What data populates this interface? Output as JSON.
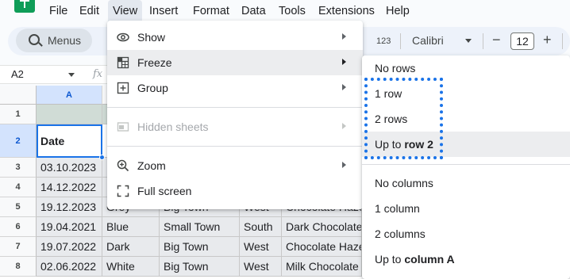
{
  "menubar": {
    "items": [
      "File",
      "Edit",
      "View",
      "Insert",
      "Format",
      "Data",
      "Tools",
      "Extensions",
      "Help"
    ],
    "active": "View"
  },
  "toolbar": {
    "menus_label": "Menus",
    "number_format": "123",
    "font": "Calibri",
    "font_size": "12",
    "minus": "−",
    "plus": "+"
  },
  "formula_bar": {
    "name_box": "A2",
    "fx": "fx"
  },
  "grid": {
    "column_headers": [
      "A"
    ],
    "row_numbers": [
      "1",
      "2",
      "3",
      "4",
      "5",
      "6",
      "7",
      "8"
    ],
    "header_cell": "Date",
    "rows": [
      [
        "03.10.2023"
      ],
      [
        "14.12.2022"
      ],
      [
        "19.12.2023",
        "Grey",
        "Big Town",
        "West",
        "Chocolate Haze"
      ],
      [
        "19.04.2021",
        "Blue",
        "Small Town",
        "South",
        "Dark Chocolate"
      ],
      [
        "19.07.2022",
        "Dark",
        "Big Town",
        "West",
        "Chocolate Haze"
      ],
      [
        "02.06.2022",
        "White",
        "Big Town",
        "West",
        "Milk Chocolate"
      ]
    ],
    "selected_cell": "A2"
  },
  "view_menu": {
    "items": [
      {
        "label": "Show",
        "icon": "eye-icon",
        "submenu": true,
        "disabled": false
      },
      {
        "label": "Freeze",
        "icon": "freeze-grid-icon",
        "submenu": true,
        "disabled": false,
        "highlighted": true
      },
      {
        "label": "Group",
        "icon": "plus-box-icon",
        "submenu": true,
        "disabled": false
      },
      {
        "label": "Hidden sheets",
        "icon": "hidden-sheet-icon",
        "submenu": true,
        "disabled": true
      },
      {
        "label": "Zoom",
        "icon": "zoom-icon",
        "submenu": true,
        "disabled": false
      },
      {
        "label": "Full screen",
        "icon": "fullscreen-icon",
        "submenu": false,
        "disabled": false
      }
    ]
  },
  "freeze_menu": {
    "no_rows": "No rows",
    "one_row": "1 row",
    "two_rows": "2 rows",
    "up_to_row_prefix": "Up to",
    "up_to_row_bold": "row 2",
    "no_columns": "No columns",
    "one_column": "1 column",
    "two_columns": "2 columns",
    "up_to_column_prefix": "Up to",
    "up_to_column_bold": "column A",
    "highlighted": "Up to row 2"
  },
  "colors": {
    "accent": "#1a73e8",
    "app_green": "#0f9d58",
    "menu_hover": "#ecedef",
    "row1_fill": "#d0dcd6"
  }
}
